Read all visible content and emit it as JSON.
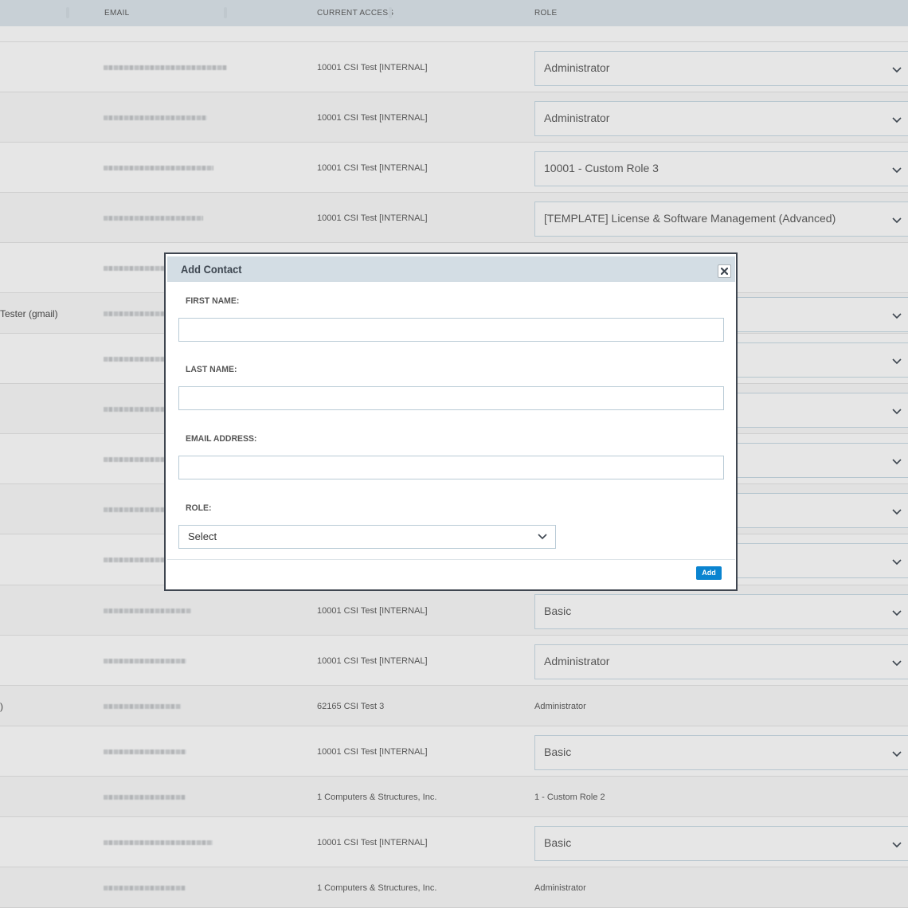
{
  "table": {
    "headers": {
      "email": "EMAIL",
      "current_access": "CURRENT ACCESS",
      "role": "ROLE"
    },
    "rows": [
      {
        "name": "",
        "email": "[redacted]",
        "access": "10001 CSI Test [INTERNAL]",
        "role": "Administrator",
        "role_editable": true
      },
      {
        "name": "",
        "email": "[redacted]",
        "access": "10001 CSI Test [INTERNAL]",
        "role": "Administrator",
        "role_editable": true
      },
      {
        "name": "",
        "email": "[redacted]",
        "access": "10001 CSI Test [INTERNAL]",
        "role": "10001 - Custom Role 3",
        "role_editable": true
      },
      {
        "name": "",
        "email": "[redacted]",
        "access": "10001 CSI Test [INTERNAL]",
        "role": "[TEMPLATE] License & Software Management (Advanced)",
        "role_editable": true
      },
      {
        "name": "",
        "email": "[redacted]",
        "access": "",
        "role": "",
        "role_editable": false
      },
      {
        "name": "Tester (gmail)",
        "email": "[redacted]",
        "access": "",
        "role": "",
        "role_editable": true
      },
      {
        "name": "",
        "email": "[redacted]",
        "access": "",
        "role": "",
        "role_editable": true
      },
      {
        "name": "",
        "email": "[redacted]",
        "access": "",
        "role": "",
        "role_editable": true
      },
      {
        "name": "",
        "email": "[redacted]",
        "access": "",
        "role": "",
        "role_editable": true
      },
      {
        "name": "",
        "email": "[redacted]",
        "access": "",
        "role": "",
        "role_editable": true
      },
      {
        "name": "",
        "email": "[redacted]",
        "access": "",
        "role": "",
        "role_editable": true
      },
      {
        "name": "",
        "email": "[redacted]",
        "access": "10001 CSI Test [INTERNAL]",
        "role": "Basic",
        "role_editable": true
      },
      {
        "name": "",
        "email": "[redacted]",
        "access": "10001 CSI Test [INTERNAL]",
        "role": "Administrator",
        "role_editable": true
      },
      {
        "name": ")",
        "email": "[redacted]",
        "access": "62165 CSI Test 3",
        "role": "Administrator",
        "role_editable": false
      },
      {
        "name": "",
        "email": "[redacted]",
        "access": "10001 CSI Test [INTERNAL]",
        "role": "Basic",
        "role_editable": true
      },
      {
        "name": "",
        "email": "[redacted]",
        "access": "1 Computers & Structures, Inc.",
        "role": "1 - Custom Role 2",
        "role_editable": false
      },
      {
        "name": "",
        "email": "[redacted]",
        "access": "10001 CSI Test [INTERNAL]",
        "role": "Basic",
        "role_editable": true
      },
      {
        "name": "",
        "email": "[redacted]",
        "access": "1 Computers & Structures, Inc.",
        "role": "Administrator",
        "role_editable": false
      }
    ]
  },
  "modal": {
    "title": "Add Contact",
    "close_icon": "close-icon",
    "fields": {
      "first_name": {
        "label": "FIRST NAME:",
        "value": ""
      },
      "last_name": {
        "label": "LAST NAME:",
        "value": ""
      },
      "email": {
        "label": "EMAIL ADDRESS:",
        "value": ""
      },
      "role": {
        "label": "ROLE:",
        "selected": "Select"
      }
    },
    "add_label": "Add"
  },
  "colors": {
    "accent": "#0a84d0",
    "header_bg": "#c8d0d6",
    "modal_header_bg": "#d3dde4"
  }
}
